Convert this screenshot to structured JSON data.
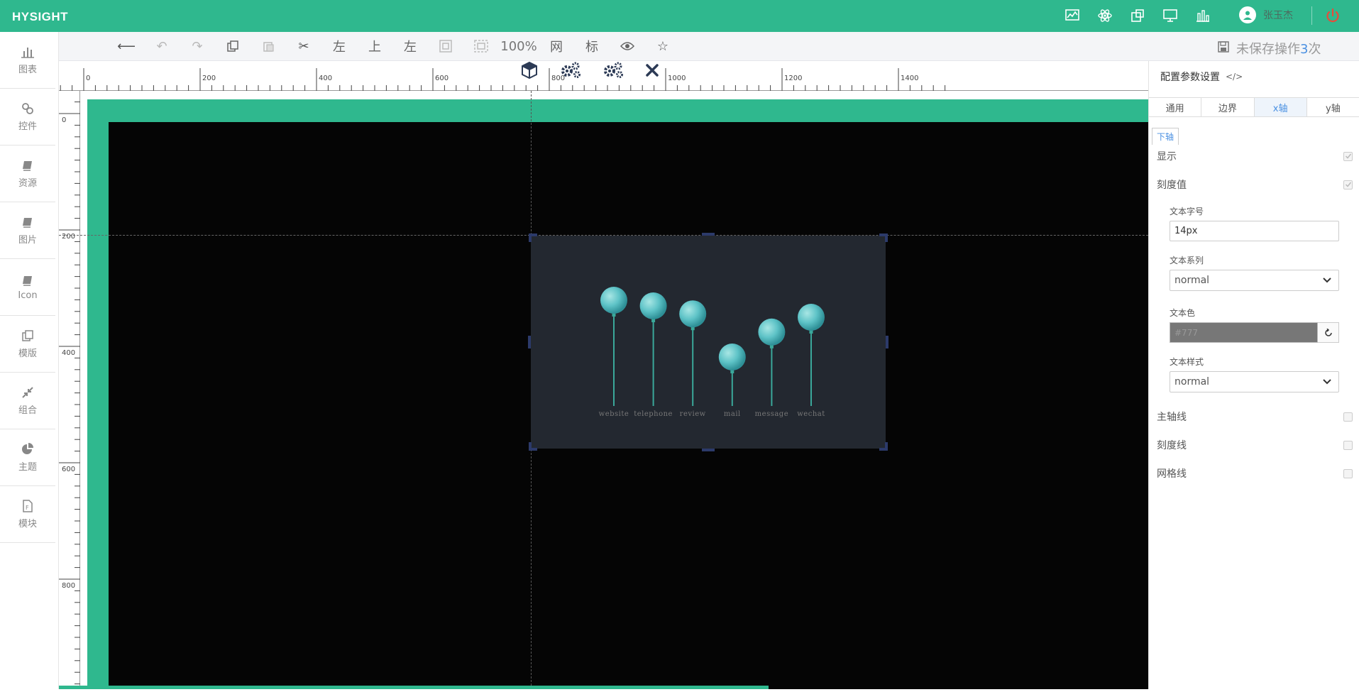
{
  "app": {
    "logo": "HYSIGHT"
  },
  "user": {
    "name": "张玉杰"
  },
  "toolbar": {
    "zoom": "100%",
    "grid_label": "网",
    "mark_label": "标",
    "align_left_1": "左",
    "align_top": "上",
    "align_left_2": "左",
    "unsaved_prefix": "未保存操作",
    "unsaved_count": "3",
    "unsaved_suffix": "次"
  },
  "sidebar": {
    "items": [
      {
        "label": "图表",
        "icon": "bar-chart-icon"
      },
      {
        "label": "控件",
        "icon": "link-icon"
      },
      {
        "label": "资源",
        "icon": "book-icon"
      },
      {
        "label": "图片",
        "icon": "book-icon"
      },
      {
        "label": "Icon",
        "icon": "book-icon"
      },
      {
        "label": "模版",
        "icon": "copy-icon"
      },
      {
        "label": "组合",
        "icon": "compress-icon"
      },
      {
        "label": "主题",
        "icon": "pie-icon"
      },
      {
        "label": "模块",
        "icon": "file-icon"
      }
    ]
  },
  "ruler": {
    "h_labels": [
      "0",
      "200",
      "400",
      "600",
      "800",
      "1000",
      "1200",
      "1400"
    ],
    "v_labels": [
      "0",
      "200",
      "400",
      "600",
      "800"
    ]
  },
  "panel": {
    "title": "配置参数设置",
    "tabs": [
      {
        "label": "通用",
        "active": false
      },
      {
        "label": "边界",
        "active": false
      },
      {
        "label": "x轴",
        "active": true
      },
      {
        "label": "y轴",
        "active": false
      }
    ],
    "subtab": "下轴",
    "show_label": "显示",
    "show_checked": true,
    "tick_value_label": "刻度值",
    "tick_value_checked": true,
    "font_size_label": "文本字号",
    "font_size_value": "14px",
    "font_family_label": "文本系列",
    "font_family_value": "normal",
    "text_color_label": "文本色",
    "text_color_value": "#777",
    "font_style_label": "文本样式",
    "font_style_value": "normal",
    "axis_line_label": "主轴线",
    "axis_line_checked": false,
    "tick_line_label": "刻度线",
    "tick_line_checked": false,
    "grid_line_label": "网格线",
    "grid_line_checked": false
  },
  "colors": {
    "brand": "#2fb88e",
    "widget_bg": "#232830",
    "balloon": "#5ec3c7",
    "stick": "#3aa89a",
    "label": "#777777"
  },
  "chart_data": {
    "type": "bar",
    "style": "balloon",
    "categories": [
      "website",
      "telephone",
      "review",
      "mail",
      "message",
      "wechat"
    ],
    "values": [
      90,
      85,
      78,
      40,
      62,
      75
    ],
    "ylim": [
      0,
      100
    ]
  }
}
